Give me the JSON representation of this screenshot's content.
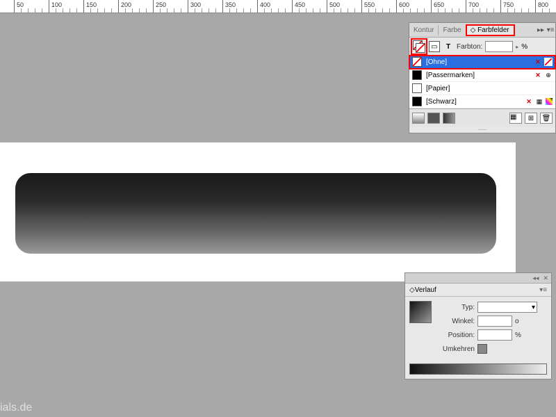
{
  "ruler": {
    "ticks": [
      50,
      100,
      150,
      200,
      250,
      300,
      350,
      400,
      450,
      500,
      550,
      600,
      650,
      700,
      750,
      800
    ]
  },
  "swatchesPanel": {
    "tabs": [
      "Kontur",
      "Farbe",
      "Farbfelder"
    ],
    "activeTab": 2,
    "farbtonLabel": "Farbton:",
    "farbtonValue": "",
    "farbtonUnit": "%",
    "swatches": [
      {
        "name": "[Ohne]",
        "color": "none",
        "selected": true,
        "locked": true,
        "noneBadge": true
      },
      {
        "name": "[Passermarken]",
        "color": "#000",
        "locked": true,
        "reg": true
      },
      {
        "name": "[Papier]",
        "color": "#fff"
      },
      {
        "name": "[Schwarz]",
        "color": "#000",
        "locked": true,
        "process": true
      }
    ]
  },
  "gradientPanel": {
    "title": "Verlauf",
    "typLabel": "Typ:",
    "winkelLabel": "Winkel:",
    "winkelValue": "",
    "winkelUnit": "o",
    "positionLabel": "Position:",
    "positionValue": "",
    "positionUnit": "%",
    "umkehrenLabel": "Umkehren"
  },
  "watermark": "ials.de"
}
